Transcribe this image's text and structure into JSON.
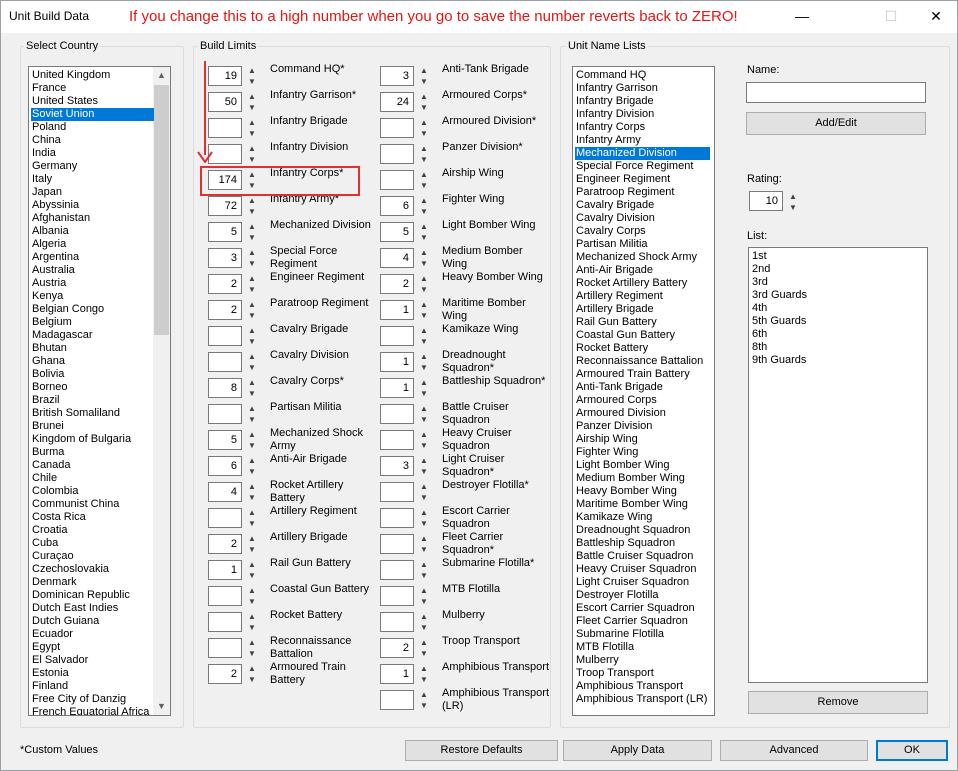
{
  "window": {
    "title": "Unit Build Data",
    "annotation": "If you change this to a high number when you go to save the number reverts back to ZERO!",
    "controls": {
      "minimize": "—",
      "maximize": "☐",
      "close": "✕"
    }
  },
  "country_group": {
    "label": "Select Country",
    "selected_index": 3,
    "items": [
      "United Kingdom",
      "France",
      "United States",
      "Soviet Union",
      "Poland",
      "China",
      "India",
      "Germany",
      "Italy",
      "Japan",
      "Abyssinia",
      "Afghanistan",
      "Albania",
      "Algeria",
      "Argentina",
      "Australia",
      "Austria",
      "Kenya",
      "Belgian Congo",
      "Belgium",
      "Madagascar",
      "Bhutan",
      "Ghana",
      "Bolivia",
      "Borneo",
      "Brazil",
      "British Somaliland",
      "Brunei",
      "Kingdom of Bulgaria",
      "Burma",
      "Canada",
      "Chile",
      "Colombia",
      "Communist China",
      "Costa Rica",
      "Croatia",
      "Cuba",
      "Curaçao",
      "Czechoslovakia",
      "Denmark",
      "Dominican Republic",
      "Dutch East Indies",
      "Dutch Guiana",
      "Ecuador",
      "Egypt",
      "El Salvador",
      "Estonia",
      "Finland",
      "Free City of Danzig",
      "French Equatorial Africa"
    ]
  },
  "build_limits": {
    "label": "Build Limits",
    "col1": [
      {
        "value": "19",
        "label": "Command HQ*"
      },
      {
        "value": "50",
        "label": "Infantry Garrison*"
      },
      {
        "value": "",
        "label": "Infantry Brigade"
      },
      {
        "value": "",
        "label": "Infantry Division"
      },
      {
        "value": "174",
        "label": "Infantry Corps*"
      },
      {
        "value": "72",
        "label": "Infantry Army*"
      },
      {
        "value": "5",
        "label": "Mechanized Division"
      },
      {
        "value": "3",
        "label": "Special Force Regiment"
      },
      {
        "value": "2",
        "label": "Engineer Regiment"
      },
      {
        "value": "2",
        "label": "Paratroop Regiment"
      },
      {
        "value": "",
        "label": "Cavalry Brigade"
      },
      {
        "value": "",
        "label": "Cavalry Division"
      },
      {
        "value": "8",
        "label": "Cavalry Corps*"
      },
      {
        "value": "",
        "label": "Partisan Militia"
      },
      {
        "value": "5",
        "label": "Mechanized Shock Army"
      },
      {
        "value": "6",
        "label": "Anti-Air Brigade"
      },
      {
        "value": "4",
        "label": "Rocket Artillery Battery"
      },
      {
        "value": "",
        "label": "Artillery Regiment"
      },
      {
        "value": "2",
        "label": "Artillery Brigade"
      },
      {
        "value": "1",
        "label": "Rail Gun Battery"
      },
      {
        "value": "",
        "label": "Coastal Gun Battery"
      },
      {
        "value": "",
        "label": "Rocket Battery"
      },
      {
        "value": "",
        "label": "Reconnaissance Battalion"
      },
      {
        "value": "2",
        "label": "Armoured Train Battery"
      }
    ],
    "col2": [
      {
        "value": "3",
        "label": "Anti-Tank Brigade"
      },
      {
        "value": "24",
        "label": "Armoured Corps*"
      },
      {
        "value": "",
        "label": "Armoured Division*"
      },
      {
        "value": "",
        "label": "Panzer Division*"
      },
      {
        "value": "",
        "label": "Airship Wing"
      },
      {
        "value": "6",
        "label": "Fighter Wing"
      },
      {
        "value": "5",
        "label": "Light Bomber Wing"
      },
      {
        "value": "4",
        "label": "Medium Bomber Wing"
      },
      {
        "value": "2",
        "label": "Heavy Bomber Wing"
      },
      {
        "value": "1",
        "label": "Maritime Bomber Wing"
      },
      {
        "value": "",
        "label": "Kamikaze Wing"
      },
      {
        "value": "1",
        "label": "Dreadnought Squadron*"
      },
      {
        "value": "1",
        "label": "Battleship Squadron*"
      },
      {
        "value": "",
        "label": "Battle Cruiser Squadron"
      },
      {
        "value": "",
        "label": "Heavy Cruiser Squadron"
      },
      {
        "value": "3",
        "label": "Light Cruiser Squadron*"
      },
      {
        "value": "",
        "label": "Destroyer Flotilla*"
      },
      {
        "value": "",
        "label": "Escort Carrier Squadron"
      },
      {
        "value": "",
        "label": "Fleet Carrier Squadron*"
      },
      {
        "value": "",
        "label": "Submarine Flotilla*"
      },
      {
        "value": "",
        "label": "MTB Flotilla"
      },
      {
        "value": "",
        "label": "Mulberry"
      },
      {
        "value": "2",
        "label": "Troop Transport"
      },
      {
        "value": "1",
        "label": "Amphibious Transport"
      },
      {
        "value": "",
        "label": "Amphibious Transport (LR)"
      }
    ]
  },
  "unit_names": {
    "label": "Unit Name Lists",
    "selected_index": 6,
    "items": [
      "Command HQ",
      "Infantry Garrison",
      "Infantry Brigade",
      "Infantry Division",
      "Infantry Corps",
      "Infantry Army",
      "Mechanized Division",
      "Special Force Regiment",
      "Engineer Regiment",
      "Paratroop Regiment",
      "Cavalry Brigade",
      "Cavalry Division",
      "Cavalry Corps",
      "Partisan Militia",
      "Mechanized Shock Army",
      "Anti-Air Brigade",
      "Rocket Artillery Battery",
      "Artillery Regiment",
      "Artillery Brigade",
      "Rail Gun Battery",
      "Coastal Gun Battery",
      "Rocket Battery",
      "Reconnaissance Battalion",
      "Armoured Train Battery",
      "Anti-Tank Brigade",
      "Armoured Corps",
      "Armoured Division",
      "Panzer Division",
      "Airship Wing",
      "Fighter Wing",
      "Light Bomber Wing",
      "Medium Bomber Wing",
      "Heavy Bomber Wing",
      "Maritime Bomber Wing",
      "Kamikaze Wing",
      "Dreadnought Squadron",
      "Battleship Squadron",
      "Battle Cruiser Squadron",
      "Heavy Cruiser Squadron",
      "Light Cruiser Squadron",
      "Destroyer Flotilla",
      "Escort Carrier Squadron",
      "Fleet Carrier Squadron",
      "Submarine Flotilla",
      "MTB Flotilla",
      "Mulberry",
      "Troop Transport",
      "Amphibious Transport",
      "Amphibious Transport (LR)"
    ],
    "name_label": "Name:",
    "name_value": "",
    "add_edit_label": "Add/Edit",
    "rating_label": "Rating:",
    "rating_value": "10",
    "list_label": "List:",
    "list_items": [
      "1st",
      "2nd",
      "3rd",
      "3rd Guards",
      "4th",
      "5th Guards",
      "6th",
      "8th",
      "9th Guards"
    ],
    "remove_label": "Remove"
  },
  "footer": {
    "note": "*Custom Values",
    "restore_defaults": "Restore Defaults",
    "apply_data": "Apply Data",
    "advanced": "Advanced",
    "ok": "OK"
  }
}
